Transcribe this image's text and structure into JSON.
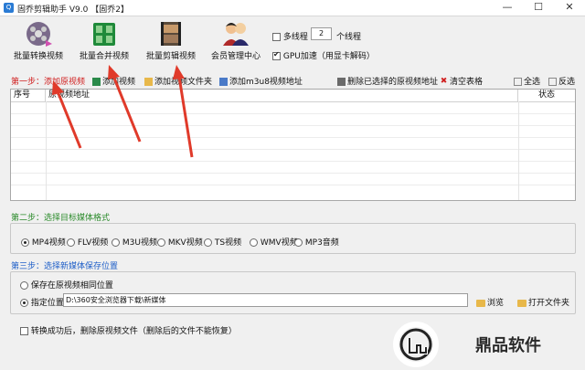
{
  "window": {
    "app_icon_text": "Q",
    "title": "固乔剪辑助手 V9.0 【固乔2】",
    "min": "—",
    "max": "☐",
    "close": "✕"
  },
  "toolbar": {
    "batch_convert": "批量转换视频",
    "batch_merge": "批量合并视频",
    "batch_edit": "批量剪辑视频",
    "member_center": "会员管理中心",
    "multithread_label": "多线程",
    "thread_count": "2",
    "thread_unit": "个线程",
    "gpu_label": "GPU加速（用显卡解码）"
  },
  "step1": {
    "label": "第一步：添加原视频",
    "add_video": "添加视频",
    "add_folder": "添加视频文件夹",
    "add_m3u8": "添加m3u8视频地址",
    "delete_selected": "删除已选择的原视频地址",
    "clear_table": "清空表格",
    "select_all": "全选",
    "invert": "反选"
  },
  "table": {
    "columns": [
      "序号",
      "原视频地址",
      "状态"
    ]
  },
  "step2": {
    "label": "第二步：选择目标媒体格式",
    "formats": [
      "MP4视频",
      "FLV视频",
      "M3U视频",
      "MKV视频",
      "TS视频",
      "WMV视频",
      "MP3音频"
    ],
    "selected_index": 0
  },
  "step3": {
    "label": "第三步：选择新媒体保存位置",
    "same_location": "保存在原视频相同位置",
    "specified": "指定位置",
    "path": "D:\\360安全浏览器下载\\新媒体",
    "browse": "浏览",
    "open_folder": "打开文件夹"
  },
  "footer": {
    "delete_after": "转换成功后，删除原视频文件（删除后的文件不能恢复）"
  },
  "watermark": {
    "text": "鼎品软件"
  },
  "colors": {
    "step_red": "#d02020",
    "step_green": "#2a8a2a",
    "step_blue": "#1f5fc8",
    "arrow_red": "#e03a2a"
  }
}
